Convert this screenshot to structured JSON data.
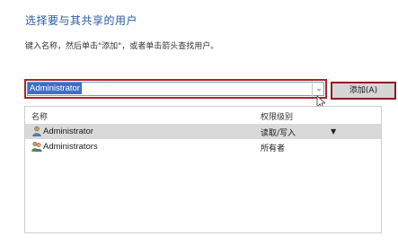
{
  "dialog": {
    "heading": "选择要与其共享的用户",
    "instruction": "键入名称，然后单击\"添加\"，或者单击箭头查找用户。"
  },
  "input": {
    "value": "Administrator",
    "dropdown_icon": "chevron-down-icon"
  },
  "add_button": {
    "label": "添加(A)"
  },
  "table": {
    "columns": {
      "name": "名称",
      "permission": "权限级别"
    },
    "rows": [
      {
        "name": "Administrator",
        "permission": "读取/写入",
        "icon": "user-icon",
        "selected": true,
        "has_dropdown": true
      },
      {
        "name": "Administrators",
        "permission": "所有者",
        "icon": "users-group-icon",
        "selected": false,
        "has_dropdown": false
      }
    ]
  },
  "colors": {
    "heading": "#2a5aa6",
    "highlight_border": "#b3202a",
    "selection": "#3c6fc8",
    "selected_row": "#d9d9d9"
  }
}
